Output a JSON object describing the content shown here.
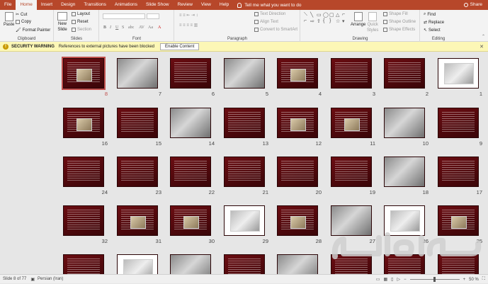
{
  "tabs": [
    "File",
    "Home",
    "Insert",
    "Design",
    "Transitions",
    "Animations",
    "Slide Show",
    "Review",
    "View",
    "Help"
  ],
  "active_tab": "Home",
  "tell_me": "Tell me what you want to do",
  "share": "Share",
  "ribbon": {
    "clipboard": {
      "label": "Clipboard",
      "paste": "Paste",
      "cut": "Cut",
      "copy": "Copy",
      "format_painter": "Format Painter"
    },
    "slides": {
      "label": "Slides",
      "new_slide_line1": "New",
      "new_slide_line2": "Slide",
      "layout": "Layout",
      "reset": "Reset",
      "section": "Section"
    },
    "font": {
      "label": "Font"
    },
    "paragraph": {
      "label": "Paragraph",
      "text_direction": "Text Direction",
      "align_text": "Align Text",
      "smartart": "Convert to SmartArt"
    },
    "drawing": {
      "label": "Drawing",
      "arrange": "Arrange",
      "quick_styles_line1": "Quick",
      "quick_styles_line2": "Styles",
      "shape_fill": "Shape Fill",
      "shape_outline": "Shape Outline",
      "shape_effects": "Shape Effects"
    },
    "editing": {
      "label": "Editing",
      "find": "Find",
      "replace": "Replace",
      "select": "Select"
    }
  },
  "security_bar": {
    "title": "SECURITY WARNING",
    "message": "References to external pictures have been blocked",
    "button": "Enable Content"
  },
  "slides": [
    {
      "num": "8",
      "kind": "red-img",
      "selected": true
    },
    {
      "num": "7",
      "kind": "img"
    },
    {
      "num": "6",
      "kind": "red"
    },
    {
      "num": "5",
      "kind": "img"
    },
    {
      "num": "4",
      "kind": "red-img"
    },
    {
      "num": "3",
      "kind": "red"
    },
    {
      "num": "2",
      "kind": "red"
    },
    {
      "num": "1",
      "kind": "white"
    },
    {
      "num": "16",
      "kind": "red-img"
    },
    {
      "num": "15",
      "kind": "red"
    },
    {
      "num": "14",
      "kind": "img"
    },
    {
      "num": "13",
      "kind": "red"
    },
    {
      "num": "12",
      "kind": "red-img"
    },
    {
      "num": "11",
      "kind": "red-img"
    },
    {
      "num": "10",
      "kind": "img"
    },
    {
      "num": "9",
      "kind": "red"
    },
    {
      "num": "24",
      "kind": "red"
    },
    {
      "num": "23",
      "kind": "red"
    },
    {
      "num": "22",
      "kind": "red"
    },
    {
      "num": "21",
      "kind": "red"
    },
    {
      "num": "20",
      "kind": "red"
    },
    {
      "num": "19",
      "kind": "red"
    },
    {
      "num": "18",
      "kind": "img"
    },
    {
      "num": "17",
      "kind": "red"
    },
    {
      "num": "32",
      "kind": "red"
    },
    {
      "num": "31",
      "kind": "red-img"
    },
    {
      "num": "30",
      "kind": "red-img"
    },
    {
      "num": "29",
      "kind": "white"
    },
    {
      "num": "28",
      "kind": "red-img"
    },
    {
      "num": "27",
      "kind": "img"
    },
    {
      "num": "26",
      "kind": "white"
    },
    {
      "num": "25",
      "kind": "red-img"
    },
    {
      "num": "",
      "kind": "red"
    },
    {
      "num": "",
      "kind": "white"
    },
    {
      "num": "",
      "kind": "img"
    },
    {
      "num": "",
      "kind": "red"
    },
    {
      "num": "",
      "kind": "img"
    },
    {
      "num": "",
      "kind": "red"
    },
    {
      "num": "",
      "kind": "red"
    },
    {
      "num": "",
      "kind": "red"
    }
  ],
  "status": {
    "slide_info": "Slide 8 of 77",
    "language": "Persian (Iran)",
    "zoom": "50 %",
    "zoom_level": 0.5
  },
  "watermark_text": "باسانی"
}
